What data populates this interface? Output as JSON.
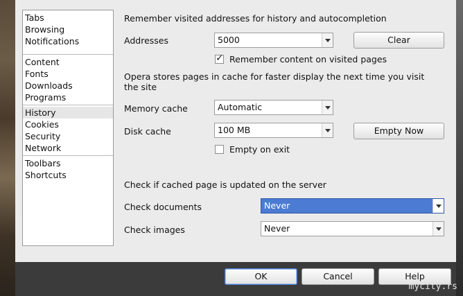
{
  "sidebar": {
    "groups": [
      {
        "items": [
          "Tabs",
          "Browsing",
          "Notifications"
        ]
      },
      {
        "items": [
          "Content",
          "Fonts",
          "Downloads",
          "Programs"
        ]
      },
      {
        "items": [
          "History",
          "Cookies",
          "Security",
          "Network"
        ]
      },
      {
        "items": [
          "Toolbars",
          "Shortcuts"
        ]
      }
    ],
    "selected": "History"
  },
  "history": {
    "heading": "Remember visited addresses for history and autocompletion",
    "addresses_label": "Addresses",
    "addresses_value": "5000",
    "clear_label": "Clear",
    "remember_content_label": "Remember content on visited pages",
    "remember_content_checked": true
  },
  "cache": {
    "heading": "Opera stores pages in cache for faster display the next time you visit the site",
    "memory_label": "Memory cache",
    "memory_value": "Automatic",
    "disk_label": "Disk cache",
    "disk_value": "100 MB",
    "empty_now_label": "Empty Now",
    "empty_on_exit_label": "Empty on exit",
    "empty_on_exit_checked": false
  },
  "check": {
    "heading": "Check if cached page is updated on the server",
    "documents_label": "Check documents",
    "documents_value": "Never",
    "images_label": "Check images",
    "images_value": "Never"
  },
  "footer": {
    "ok_label": "OK",
    "cancel_label": "Cancel",
    "help_label": "Help"
  },
  "watermark": "mycity.rs",
  "colors": {
    "highlight": "#4b7bd3",
    "panel": "#ebebeb"
  }
}
